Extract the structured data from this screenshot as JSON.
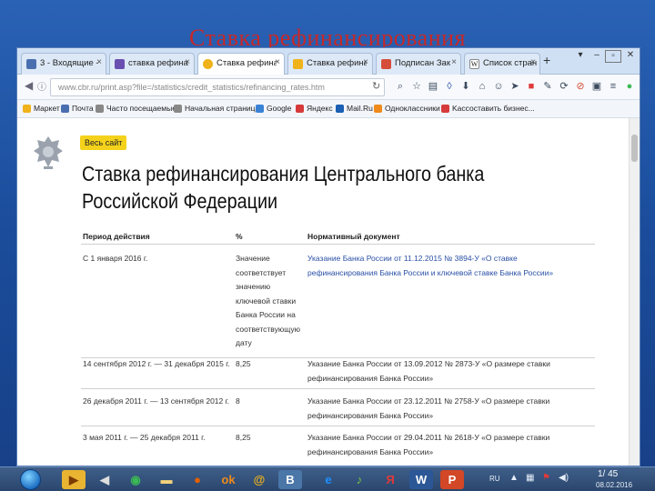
{
  "slide": {
    "title": "Ставка рефинансирования",
    "page_number": "1/ 45"
  },
  "browser": {
    "tabs": [
      {
        "label": "3 - Входящие -",
        "color": "#4a6fb0",
        "active": false
      },
      {
        "label": "ставка рефина",
        "color": "#6a4fb0",
        "active": false
      },
      {
        "label": "Ставка рефина",
        "color": "#f0b21b",
        "active": true
      },
      {
        "label": "Ставка рефина",
        "color": "#f0b21b",
        "active": false
      },
      {
        "label": "Подписан Зак",
        "color": "#d64e3a",
        "active": false
      },
      {
        "label": "Список стран",
        "color": "#555555",
        "active": false
      }
    ],
    "url": "www.cbr.ru/print.asp?file=/statistics/credit_statistics/refinancing_rates.htm",
    "bookmarks": [
      {
        "label": "Маркет",
        "color": "#f0b21b"
      },
      {
        "label": "Почта",
        "color": "#4a6fb0"
      },
      {
        "label": "Часто посещаемые",
        "color": "#888888"
      },
      {
        "label": "Начальная страница",
        "color": "#888888"
      },
      {
        "label": "Google",
        "color": "#3a82d6"
      },
      {
        "label": "Яндекс",
        "color": "#d63a3a"
      },
      {
        "label": "Mail.Ru",
        "color": "#1a5fb4"
      },
      {
        "label": "Одноклассники",
        "color": "#f08a1b"
      },
      {
        "label": "Kaссоставить бизнес...",
        "color": "#d63a3a"
      }
    ]
  },
  "page": {
    "all_site_label": "Весь сайт",
    "title_line1": "Ставка рефинансирования Центрального банка",
    "title_line2": "Российской Федерации",
    "headers": {
      "period": "Период действия",
      "percent": "%",
      "document": "Нормативный документ"
    },
    "rows": [
      {
        "period": "С 1 января 2016 г.",
        "percent_lines": [
          "Значение",
          "соответствует",
          "значению",
          "ключевой ставки",
          "Банка России на",
          "соответствующую",
          "дату"
        ],
        "doc_line1": "Указание Банка России от 11.12.2015 № 3894-У «О ставке",
        "doc_line2": "рефинансирования Банка России и ключевой ставке Банка России»",
        "doc_is_link": true
      },
      {
        "period": "14 сентября 2012 г. — 31 декабря 2015 г.",
        "percent_lines": [
          "8,25"
        ],
        "doc_line1": "Указание Банка России от 13.09.2012 № 2873-У «О размере ставки",
        "doc_line2": "рефинансирования Банка России»",
        "doc_is_link": false
      },
      {
        "period": "26 декабря 2011 г. — 13 сентября 2012 г.",
        "percent_lines": [
          "8"
        ],
        "doc_line1": "Указание Банка России от 23.12.2011 № 2758-У «О размере ставки",
        "doc_line2": "рефинансирования Банка России»",
        "doc_is_link": false
      },
      {
        "period": "3 мая 2011 г. — 25 декабря 2011 г.",
        "percent_lines": [
          "8,25"
        ],
        "doc_line1": "Указание Банка России от 29.04.2011 № 2618-У «О размере ставки",
        "doc_line2": "рефинансирования Банка России»",
        "doc_is_link": false
      }
    ]
  },
  "taskbar": {
    "lang": "RU",
    "clock_date": "08.02.2016",
    "apps": [
      {
        "name": "media-player",
        "glyph": "▶",
        "color": "#e8b432"
      },
      {
        "name": "volume",
        "glyph": "◀",
        "color": "#dddddd"
      },
      {
        "name": "chrome",
        "glyph": "●",
        "color": "#3cba54"
      },
      {
        "name": "folder",
        "glyph": "▬",
        "color": "#f4d27a"
      },
      {
        "name": "firefox",
        "glyph": "●",
        "color": "#e66000"
      },
      {
        "name": "odnoklassniki",
        "glyph": "ok",
        "color": "#f08a1b"
      },
      {
        "name": "mail",
        "glyph": "@",
        "color": "#f0b21b"
      },
      {
        "name": "vk",
        "glyph": "В",
        "color": "#4a76a8"
      },
      {
        "name": "ie",
        "glyph": "e",
        "color": "#1e90ff"
      },
      {
        "name": "music",
        "glyph": "♪",
        "color": "#7ac943"
      },
      {
        "name": "yandex",
        "glyph": "Я",
        "color": "#e03a3a"
      },
      {
        "name": "word",
        "glyph": "W",
        "color": "#2b5797"
      },
      {
        "name": "powerpoint",
        "glyph": "P",
        "color": "#d24726"
      }
    ]
  }
}
